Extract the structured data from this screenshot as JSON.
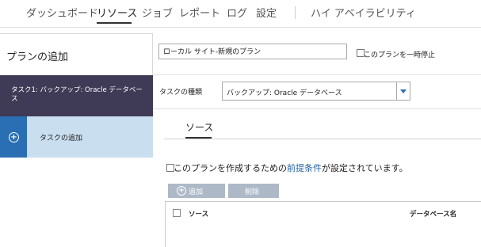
{
  "nav": {
    "items": [
      "ダッシュボード",
      "リソース",
      "ジョブ",
      "レポート",
      "ログ",
      "設定",
      "ハイ アベイラビリティ"
    ],
    "active_index": 1,
    "separator": "|"
  },
  "sidebar": {
    "title": "プランの追加",
    "tasks": [
      {
        "label": "タスク1: バックアップ: Oracle データベース"
      },
      {
        "label": "タスクの追加"
      }
    ]
  },
  "plan": {
    "name_value": "ローカル サイト-新規のプラン",
    "pause_label": "このプランを一時停止",
    "pause_checked": false
  },
  "task_type": {
    "label": "タスクの種類",
    "selected": "バックアップ: Oracle データベース"
  },
  "tabs": {
    "active": "ソース"
  },
  "source": {
    "prereq_before": "このプランを作成するための",
    "prereq_link": "前提条件",
    "prereq_after": "が設定されています。",
    "prereq_checked": false,
    "add_button": "追加",
    "delete_button": "削除",
    "columns": [
      "ソース",
      "データベース名"
    ]
  },
  "colors": {
    "dark_task_bg": "#3f3a55",
    "add_task_bg": "#c9deef",
    "accent_blue": "#2a6fb3",
    "link": "#1f5fa6",
    "disabled_button": "#aeb9c7"
  },
  "icons": [
    "plus-circle-icon",
    "dropdown-arrow-icon",
    "checkbox-icon"
  ]
}
